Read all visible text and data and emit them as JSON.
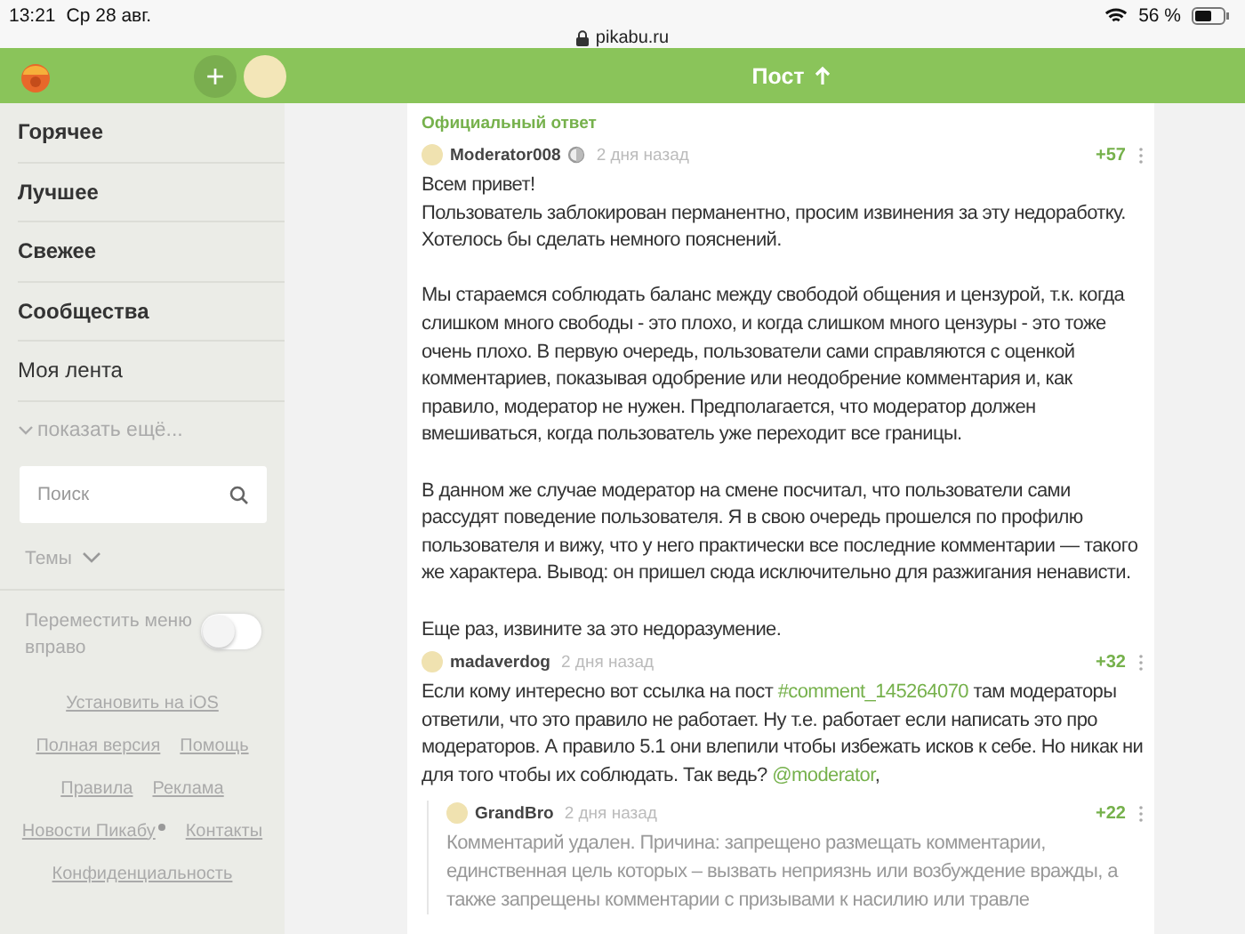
{
  "status_bar": {
    "time": "13:21",
    "date": "Ср 28 авг.",
    "battery": "56 %",
    "url": "pikabu.ru"
  },
  "header": {
    "title": "Пост",
    "add_label": "+"
  },
  "sidebar": {
    "items": [
      {
        "label": "Горячее",
        "bold": true
      },
      {
        "label": "Лучшее",
        "bold": true
      },
      {
        "label": "Свежее",
        "bold": true
      },
      {
        "label": "Сообщества",
        "bold": true
      },
      {
        "label": "Моя лента",
        "bold": false
      }
    ],
    "show_more": "показать ещё...",
    "search": {
      "placeholder": "Поиск"
    },
    "themes": "Темы",
    "move_menu": {
      "label": "Переместить меню вправо",
      "on": false
    },
    "footer_rows": [
      [
        {
          "label": "Установить на iOS",
          "new": false
        }
      ],
      [
        {
          "label": "Полная версия",
          "new": false
        },
        {
          "label": "Помощь",
          "new": false
        }
      ],
      [
        {
          "label": "Правила",
          "new": false
        },
        {
          "label": "Реклама",
          "new": false
        }
      ],
      [
        {
          "label": "Новости Пикабу",
          "new": true
        },
        {
          "label": "Контакты",
          "new": false
        }
      ],
      [
        {
          "label": "Конфиденциальность",
          "new": false
        }
      ]
    ]
  },
  "comments": [
    {
      "badge": "Официальный ответ",
      "author": "Moderator008",
      "moderator": true,
      "time": "2 дня назад",
      "rating": "+57",
      "deleted": false,
      "nested": false,
      "paragraphs": [
        [
          {
            "kind": "text",
            "text": "Всем привет!"
          }
        ],
        [
          {
            "kind": "text",
            "text": "Пользователь заблокирован перманентно, просим извинения за эту недоработку."
          }
        ],
        [
          {
            "kind": "text",
            "text": "Хотелось бы сделать немного пояснений."
          }
        ],
        [
          {
            "kind": "gap"
          }
        ],
        [
          {
            "kind": "text",
            "text": "Мы стараемся соблюдать баланс между свободой общения и цензурой, т.к. когда слишком много свободы - это плохо, и когда слишком много цензуры - это тоже очень плохо. В первую очередь, пользователи сами справляются с оценкой комментариев, показывая одобрение или неодобрение комментария и, как правило, модератор не нужен. Предполагается, что модератор должен вмешиваться, когда пользователь уже переходит все границы."
          }
        ],
        [
          {
            "kind": "gap"
          }
        ],
        [
          {
            "kind": "text",
            "text": "В данном же случае модератор на смене посчитал, что пользователи сами рассудят поведение пользователя. Я в свою очередь прошелся по профилю пользователя и вижу, что у него практически все последние комментарии — такого же характера. Вывод: он пришел сюда исключительно для разжигания ненависти."
          }
        ],
        [
          {
            "kind": "gap"
          }
        ],
        [
          {
            "kind": "text",
            "text": "Еще раз, извините за это недоразумение."
          }
        ]
      ]
    },
    {
      "author": "madaverdog",
      "moderator": false,
      "time": "2 дня назад",
      "rating": "+32",
      "deleted": false,
      "nested": false,
      "paragraphs": [
        [
          {
            "kind": "text",
            "text": "Если кому интересно вот ссылка на пост "
          },
          {
            "kind": "link",
            "text": "#comment_145264070"
          },
          {
            "kind": "text",
            "text": " там модераторы ответили, что это правило не работает. Ну т.е. работает если написать это про модераторов. А правило 5.1 они влепили чтобы избежать исков к себе. Но никак ни для того чтобы их соблюдать. Так ведь? "
          },
          {
            "kind": "link",
            "text": "@moderator"
          },
          {
            "kind": "text",
            "text": ","
          }
        ]
      ]
    },
    {
      "author": "GrandBro",
      "moderator": false,
      "time": "2 дня назад",
      "rating": "+22",
      "deleted": true,
      "nested": true,
      "paragraphs": [
        [
          {
            "kind": "text",
            "text": "Комментарий удален. Причина: запрещено размещать комментарии, единственная цель которых – вызвать неприязнь или возбуждение вражды, а также запрещены комментарии с призывами к насилию или травле"
          }
        ]
      ]
    }
  ]
}
